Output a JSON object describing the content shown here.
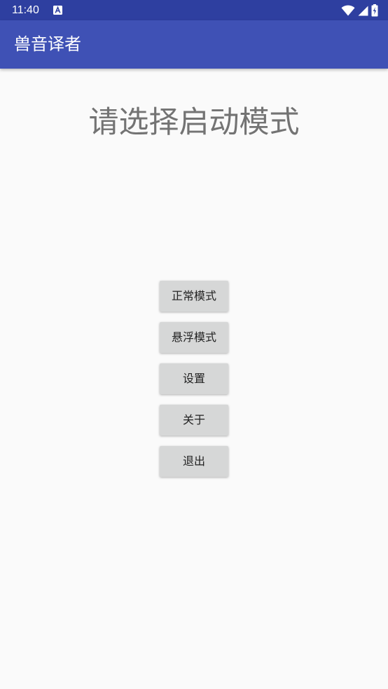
{
  "status_bar": {
    "time": "11:40",
    "notification_icon": "a-icon",
    "wifi_icon": "wifi-icon",
    "signal_icon": "signal-icon",
    "battery_icon": "battery-charging-icon",
    "background": "#2e3fa0"
  },
  "app_bar": {
    "title": "兽音译者",
    "color": "#3f51b5"
  },
  "main": {
    "heading": "请选择启动模式",
    "buttons": [
      {
        "label": "正常模式"
      },
      {
        "label": "悬浮模式"
      },
      {
        "label": "设置"
      },
      {
        "label": "关于"
      },
      {
        "label": "退出"
      }
    ]
  }
}
